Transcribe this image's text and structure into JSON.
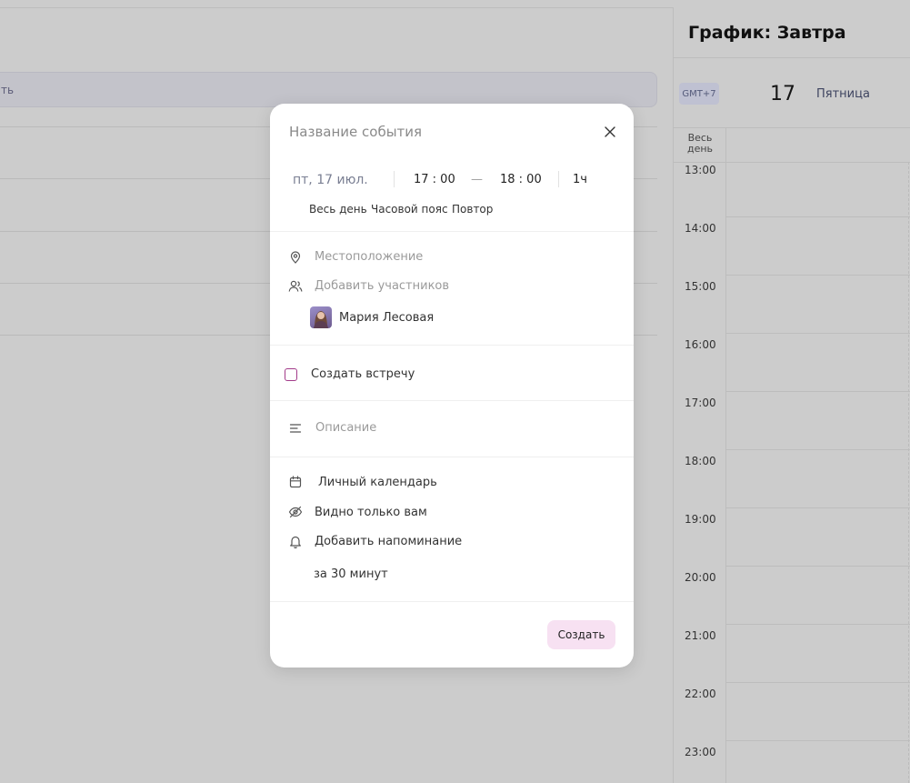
{
  "background": {
    "search_text": "ть"
  },
  "schedule": {
    "title": "График: Завтра",
    "timezone": "GMT+7",
    "day_number": "17",
    "day_name": "Пятница",
    "all_day_label": "Весь день",
    "hours": [
      "13:00",
      "14:00",
      "15:00",
      "16:00",
      "17:00",
      "18:00",
      "19:00",
      "20:00",
      "21:00",
      "22:00",
      "23:00"
    ]
  },
  "modal": {
    "title_placeholder": "Название события",
    "date": "пт, 17 июл.",
    "start_time": "17 : 00",
    "separator": "—",
    "end_time": "18 : 00",
    "duration": "1ч",
    "options": {
      "all_day": "Весь день",
      "timezone": "Часовой пояс",
      "repeat": "Повтор"
    },
    "location_placeholder": "Местоположение",
    "participants_placeholder": "Добавить участников",
    "participant_name": "Мария Лесовая",
    "create_meeting_label": "Создать встречу",
    "description_placeholder": "Описание",
    "calendar_label": "Личный календарь",
    "visibility_label": "Видно только вам",
    "reminder_label": "Добавить напоминание",
    "reminder_value": "за 30 минут",
    "create_button": "Создать"
  },
  "colors": {
    "accent_checkbox": "#a23b8a",
    "create_button_bg": "#f7e1f2"
  }
}
